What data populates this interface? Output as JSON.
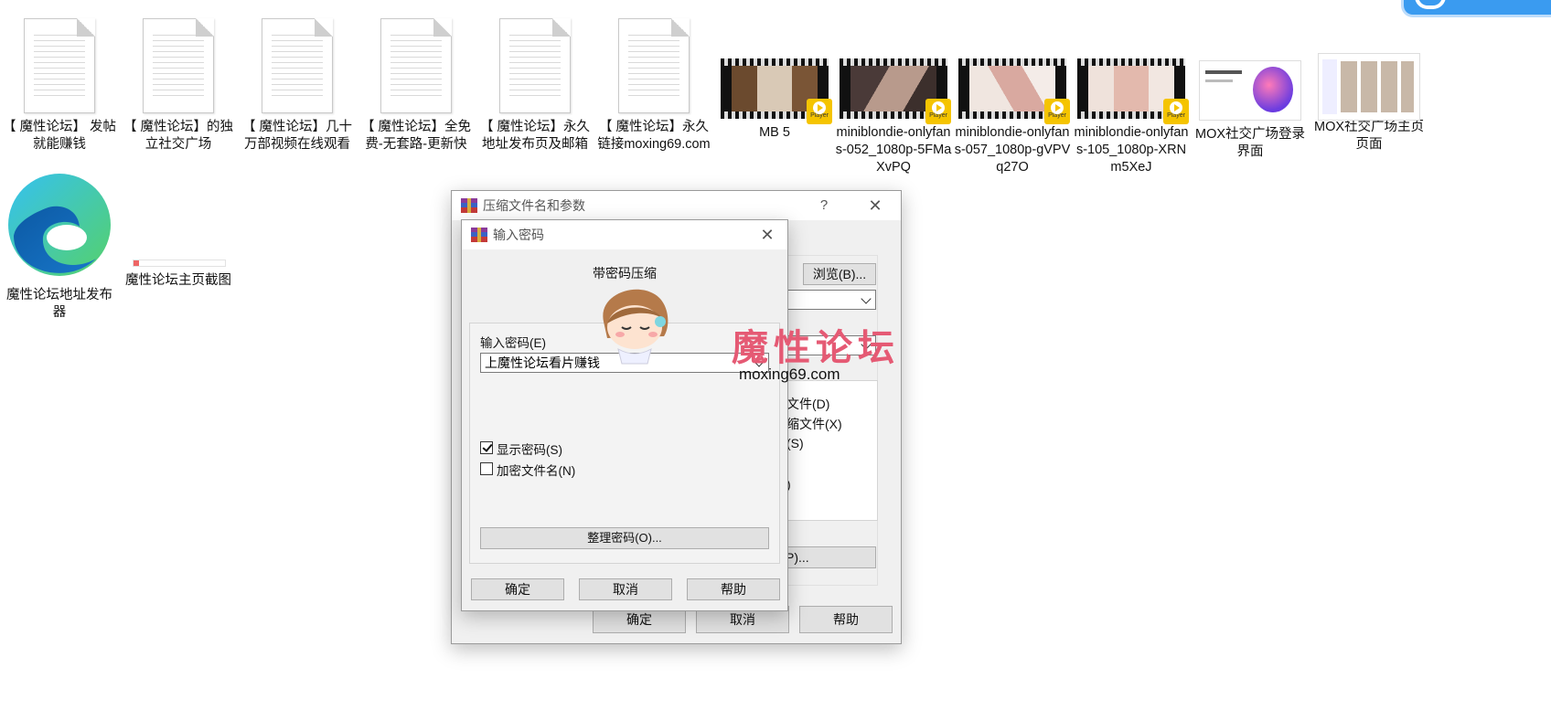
{
  "desktop": {
    "icons_row1": [
      {
        "label": "【 魔性论坛】 发帖就能赚钱",
        "kind": "doc"
      },
      {
        "label": "【 魔性论坛】的独立社交广场",
        "kind": "doc"
      },
      {
        "label": "【 魔性论坛】几十万部视频在线观看",
        "kind": "doc"
      },
      {
        "label": "【 魔性论坛】全免费-无套路-更新快",
        "kind": "doc"
      },
      {
        "label": "【 魔性论坛】永久地址发布页及邮箱",
        "kind": "doc"
      },
      {
        "label": "【 魔性论坛】永久链接moxing69.com",
        "kind": "doc"
      },
      {
        "label": "MB 5",
        "kind": "video",
        "badge": "Player"
      },
      {
        "label": "miniblondie-onlyfans-052_1080p-5FMaXvPQ",
        "kind": "video",
        "badge": "Player"
      },
      {
        "label": "miniblondie-onlyfans-057_1080p-gVPVq27O",
        "kind": "video",
        "badge": "Player"
      },
      {
        "label": "miniblondie-onlyfans-105_1080p-XRNm5XeJ",
        "kind": "video",
        "badge": "Player"
      },
      {
        "label": "MOX社交广场登录界面",
        "kind": "shot"
      },
      {
        "label": "MOX社交广场主页页面",
        "kind": "shot"
      }
    ],
    "icons_row2": [
      {
        "label": "魔性论坛地址发布器",
        "kind": "edge"
      },
      {
        "label": "魔性论坛主页截图",
        "kind": "shot"
      }
    ]
  },
  "back_dialog": {
    "title": "压缩文件名和参数",
    "help_glyph": "?",
    "close_glyph": "✕",
    "browse_label": "浏览(B)...",
    "opt1": "文件(D)",
    "opt2": "缩文件(X)",
    "opt3": "(S)",
    "opt4": ")",
    "btn_partial": "P)...",
    "ok": "确定",
    "cancel": "取消",
    "help": "帮助"
  },
  "password_dialog": {
    "title": "输入密码",
    "close_glyph": "✕",
    "heading": "带密码压缩",
    "field_label": "输入密码(E)",
    "password_value": "上魔性论坛看片赚钱",
    "show_password": "显示密码(S)",
    "show_password_checked": true,
    "encrypt_names": "加密文件名(N)",
    "encrypt_names_checked": false,
    "organize": "整理密码(O)...",
    "ok": "确定",
    "cancel": "取消",
    "help": "帮助"
  },
  "watermark": {
    "text": "魔性论坛",
    "url": "moxing69.com"
  },
  "colors": {
    "accent_blue": "#3a9bf0",
    "watermark_pink": "#e55a74",
    "player_badge": "#f5c400"
  }
}
